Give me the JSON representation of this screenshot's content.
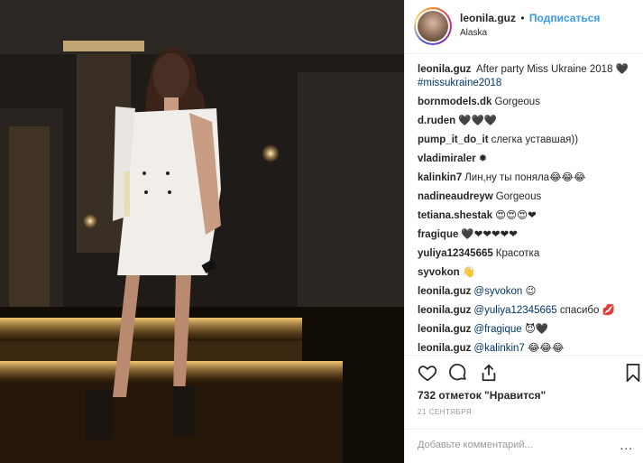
{
  "post": {
    "username": "leonila.guz",
    "separator": "•",
    "follow_label": "Подписаться",
    "location": "Alaska",
    "caption": {
      "user": "leonila.guz",
      "text": "After party Miss Ukraine 2018",
      "emoji": "🖤",
      "hashtag": "#missukraine2018"
    },
    "comments": [
      {
        "user": "bornmodels.dk",
        "text": "Gorgeous"
      },
      {
        "user": "d.ruden",
        "text": "🖤🖤🖤"
      },
      {
        "user": "pump_it_do_it",
        "text": "слегка уставшая))"
      },
      {
        "user": "vladimiraler",
        "text": "✹"
      },
      {
        "user": "kalinkin7",
        "text": "Лин,ну ты поняла😂😂😂"
      },
      {
        "user": "nadineaudreyw",
        "text": "Gorgeous"
      },
      {
        "user": "tetiana.shestak",
        "text": "😍😍😍❤"
      },
      {
        "user": "fragique",
        "text": "🖤❤❤❤❤❤"
      },
      {
        "user": "yuliya12345665",
        "text": "Красотка"
      },
      {
        "user": "syvokon",
        "text": "👋"
      },
      {
        "user": "leonila.guz",
        "mention": "@syvokon",
        "text": "😉"
      },
      {
        "user": "leonila.guz",
        "mention": "@yuliya12345665",
        "text": "спасибо 💋"
      },
      {
        "user": "leonila.guz",
        "mention": "@fragique",
        "text": "😈🖤"
      },
      {
        "user": "leonila.guz",
        "mention": "@kalinkin7",
        "text": "😂😂😂"
      }
    ],
    "likes_text": "732 отметок \"Нравится\"",
    "date": "21 СЕНТЯБРЯ",
    "add_comment_placeholder": "Добавьте комментарий...",
    "more_label": "..."
  },
  "icons": {
    "like": "heart-icon",
    "comment": "comment-icon",
    "share": "share-icon",
    "save": "bookmark-icon"
  },
  "colors": {
    "link_blue": "#3897f0",
    "mention_blue": "#003569",
    "text": "#262626"
  }
}
